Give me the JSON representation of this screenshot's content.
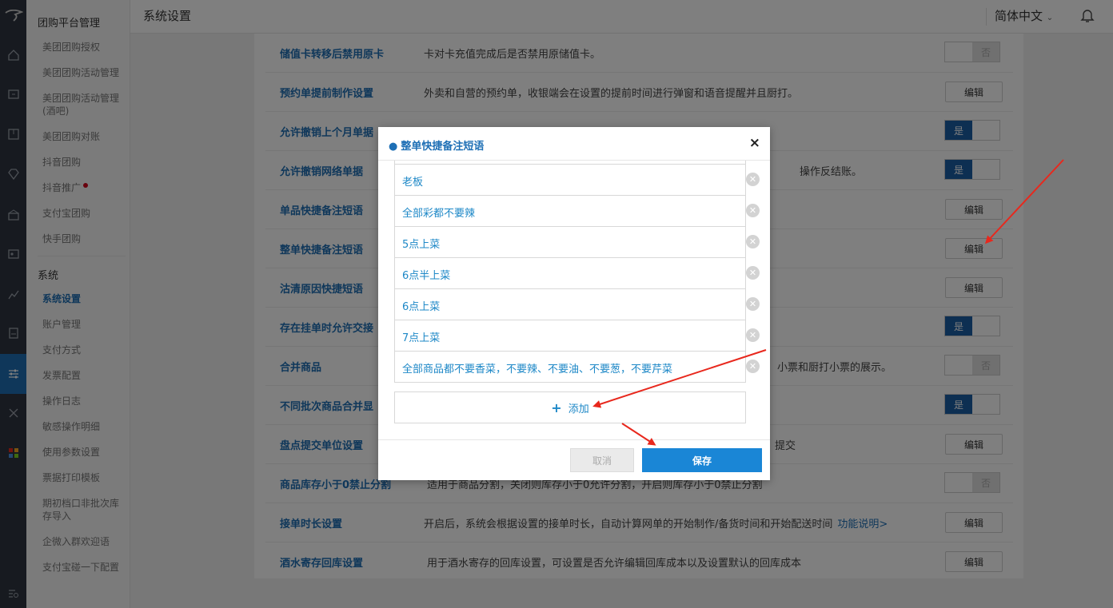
{
  "header": {
    "title": "系统设置",
    "language": "简体中文"
  },
  "sidebar": {
    "group_groupon": "团购平台管理",
    "groupon_items": [
      {
        "label": "美团团购授权"
      },
      {
        "label": "美团团购活动管理"
      },
      {
        "label": "美团团购活动管理(酒吧)"
      },
      {
        "label": "美团团购对账"
      },
      {
        "label": "抖音团购"
      },
      {
        "label": "抖音推广"
      },
      {
        "label": "支付宝团购"
      },
      {
        "label": "快手团购"
      }
    ],
    "group_system": "系统",
    "system_items": [
      {
        "label": "系统设置"
      },
      {
        "label": "账户管理"
      },
      {
        "label": "支付方式"
      },
      {
        "label": "发票配置"
      },
      {
        "label": "操作日志"
      },
      {
        "label": "敏感操作明细"
      },
      {
        "label": "使用参数设置"
      },
      {
        "label": "票据打印模板"
      },
      {
        "label": "期初档口非批次库存导入"
      },
      {
        "label": "企微入群欢迎语"
      },
      {
        "label": "支付宝碰一下配置"
      }
    ]
  },
  "settings": {
    "rows": [
      {
        "label": "储值卡转移后禁用原卡",
        "desc": "卡对卡充值完成后是否禁用原储值卡。",
        "control": "否"
      },
      {
        "label": "预约单提前制作设置",
        "desc": "外卖和自营的预约单，收银端会在设置的提前时间进行弹窗和语音提醒并且厨打。",
        "control": "编辑"
      },
      {
        "label": "允许撤销上个月单据",
        "desc": "",
        "control": "是"
      },
      {
        "label": "允许撤销网络单据",
        "desc": "操作反结账。",
        "control": "是"
      },
      {
        "label": "单品快捷备注短语",
        "desc": "",
        "control": "编辑"
      },
      {
        "label": "整单快捷备注短语",
        "desc": "",
        "control": "编辑"
      },
      {
        "label": "沽清原因快捷短语",
        "desc": "",
        "control": "编辑"
      },
      {
        "label": "存在挂单时允许交接",
        "desc": "",
        "control": "是"
      },
      {
        "label": "合并商品",
        "desc": "小票和厨打小票的展示。",
        "control": "否"
      },
      {
        "label": "不同批次商品合并显",
        "desc": "",
        "control": "是"
      },
      {
        "label": "盘点提交单位设置",
        "desc": "提交",
        "control": "编辑"
      },
      {
        "label": "商品库存小于0禁止分割",
        "desc": "适用于商品分割，关闭则库存小于0允许分割，开启则库存小于0禁止分割",
        "control": "否"
      },
      {
        "label": "接单时长设置",
        "desc": "开启后，系统会根据设置的接单时长，自动计算网单的开始制作/备货时间和开始配送时间",
        "link": "功能说明>",
        "control": "编辑"
      },
      {
        "label": "酒水寄存回库设置",
        "desc": "用于酒水寄存的回库设置，可设置是否允许编辑回库成本以及设置默认的回库成本",
        "control": "编辑"
      }
    ]
  },
  "modal": {
    "title": "整单快捷备注短语",
    "close": "×",
    "phrases": [
      {
        "text": ""
      },
      {
        "text": "老板"
      },
      {
        "text": "全部彩都不要辣"
      },
      {
        "text": "5点上菜"
      },
      {
        "text": "6点半上菜"
      },
      {
        "text": "6点上菜"
      },
      {
        "text": "7点上菜"
      },
      {
        "text": "全部商品都不要香菜，不要辣、不要油、不要葱，不要芹菜"
      }
    ],
    "add_label": "添加",
    "cancel_label": "取消",
    "save_label": "保存"
  },
  "colors": {
    "accent": "#1e6fb5",
    "primary_button": "#1a86d6",
    "arrow": "#e8281d"
  }
}
